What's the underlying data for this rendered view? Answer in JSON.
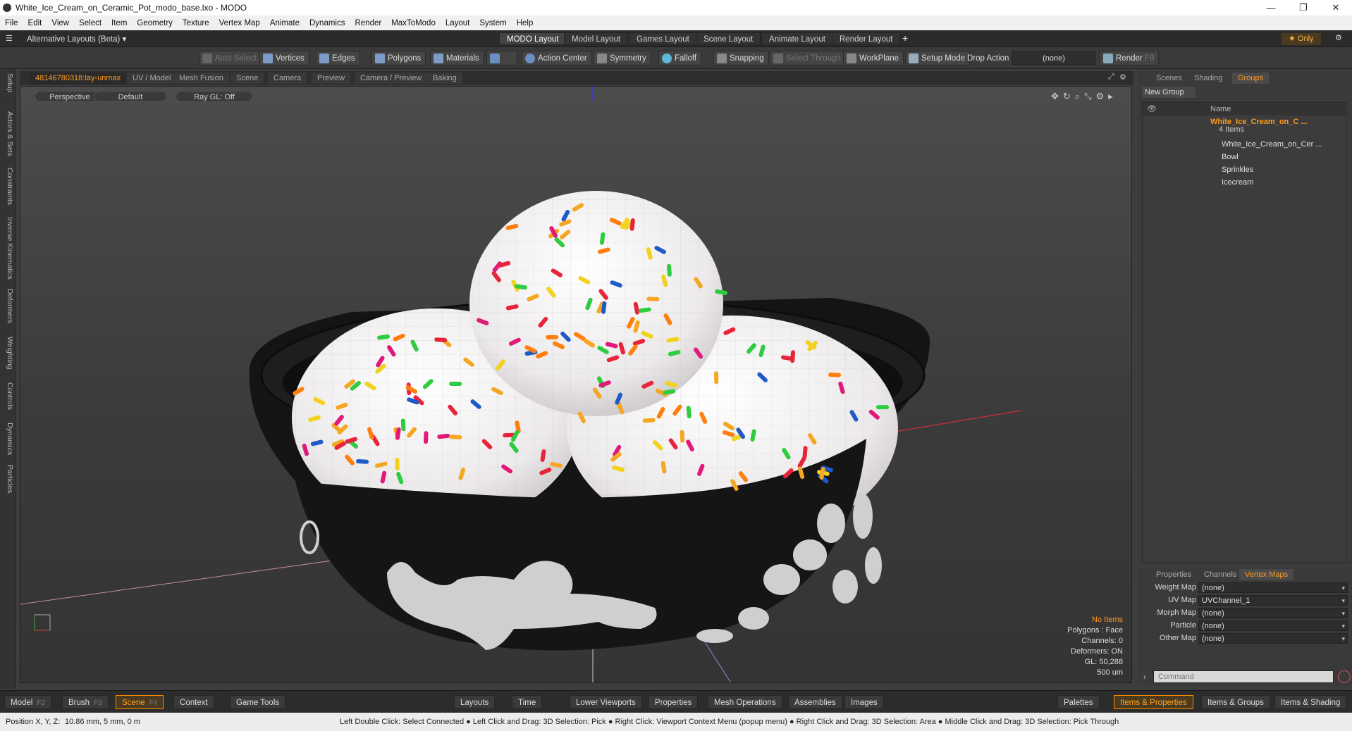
{
  "window": {
    "title": "White_Ice_Cream_on_Ceramic_Pot_modo_base.lxo - MODO",
    "minimize": "—",
    "maximize": "❐",
    "close": "✕"
  },
  "menu": [
    "File",
    "Edit",
    "View",
    "Select",
    "Item",
    "Geometry",
    "Texture",
    "Vertex Map",
    "Animate",
    "Dynamics",
    "Render",
    "MaxToModo",
    "Layout",
    "System",
    "Help"
  ],
  "layoutbar": {
    "selector": "Alternative Layouts (Beta) ▾",
    "tabs": [
      "MODO Layout",
      "Model Layout",
      "Games Layout",
      "Scene Layout",
      "Animate Layout",
      "Render Layout"
    ],
    "add": "+",
    "only": "★ Only"
  },
  "toolbar": {
    "auto_select": "Auto Select",
    "vertices": "Vertices",
    "edges": "Edges",
    "polygons": "Polygons",
    "materials": "Materials",
    "action_center": "Action Center",
    "symmetry": "Symmetry",
    "falloff": "Falloff",
    "snapping": "Snapping",
    "select_through": "Select Through",
    "workplane": "WorkPlane",
    "setup_mode": "Setup Mode",
    "drop_action": "Drop Action",
    "drop_value": "(none)",
    "render": "Render",
    "render_key": "F9"
  },
  "left_tabs": [
    "Setup",
    "Actors & Sets",
    "Constraints",
    "Inverse Kinematics",
    "Deformers",
    "Weighting",
    "Controls",
    "Dynamics",
    "Particles"
  ],
  "viewport_tabs": [
    "48146780318:lay-unmax",
    "UV / Model",
    "Mesh Fusion",
    "Scene",
    "Camera",
    "Preview",
    "Camera / Preview",
    "Baking"
  ],
  "viewport": {
    "projection": "Perspective",
    "shading": "Default",
    "raygl": "Ray GL: Off",
    "info": {
      "items": "No Items",
      "polygons": "Polygons : Face",
      "channels": "Channels: 0",
      "deformers": "Deformers: ON",
      "gl": "GL: 50,288",
      "unit": "500 um"
    }
  },
  "right_tabs": [
    "Scenes",
    "Shading",
    "Groups"
  ],
  "groups": {
    "new_group": "New Group",
    "name_header": "Name",
    "root": "White_Ice_Cream_on_C ...",
    "root_count": "4 Items",
    "children": [
      "White_Ice_Cream_on_Cer ...",
      "Bowl",
      "Sprinkles",
      "Icecream"
    ]
  },
  "prop_tabs": [
    "Properties",
    "Channels",
    "Vertex Maps"
  ],
  "vertex_maps": [
    {
      "label": "Weight Map",
      "value": "(none)"
    },
    {
      "label": "UV Map",
      "value": "UVChannel_1"
    },
    {
      "label": "Morph Map",
      "value": "(none)"
    },
    {
      "label": "Particle",
      "value": "(none)"
    },
    {
      "label": "Other Map",
      "value": "(none)"
    }
  ],
  "command_placeholder": "Command",
  "bottom": {
    "left": [
      {
        "label": "Model",
        "key": "F2"
      },
      {
        "label": "Brush",
        "key": "F3"
      },
      {
        "label": "Scene",
        "key": "F4"
      },
      {
        "label": "Context",
        "key": ""
      },
      {
        "label": "Game Tools",
        "key": ""
      }
    ],
    "mid": [
      "Layouts",
      "Time",
      "Lower Viewports",
      "Properties",
      "Mesh Operations",
      "Assemblies",
      "Images"
    ],
    "right": [
      "Palettes",
      "Items & Properties",
      "Items & Groups",
      "Items & Shading"
    ]
  },
  "status": {
    "position_label": "Position X, Y, Z:",
    "position_value": "10.86 mm, 5 mm, 0 m",
    "hint": "Left Double Click: Select Connected ● Left Click and Drag: 3D Selection: Pick ● Right Click: Viewport Context Menu (popup menu) ● Right Click and Drag: 3D Selection: Area ● Middle Click and Drag: 3D Selection: Pick Through"
  },
  "colors": {
    "accent": "#ff9c1e",
    "bowl": "#161616",
    "icecream": "#efeced"
  }
}
